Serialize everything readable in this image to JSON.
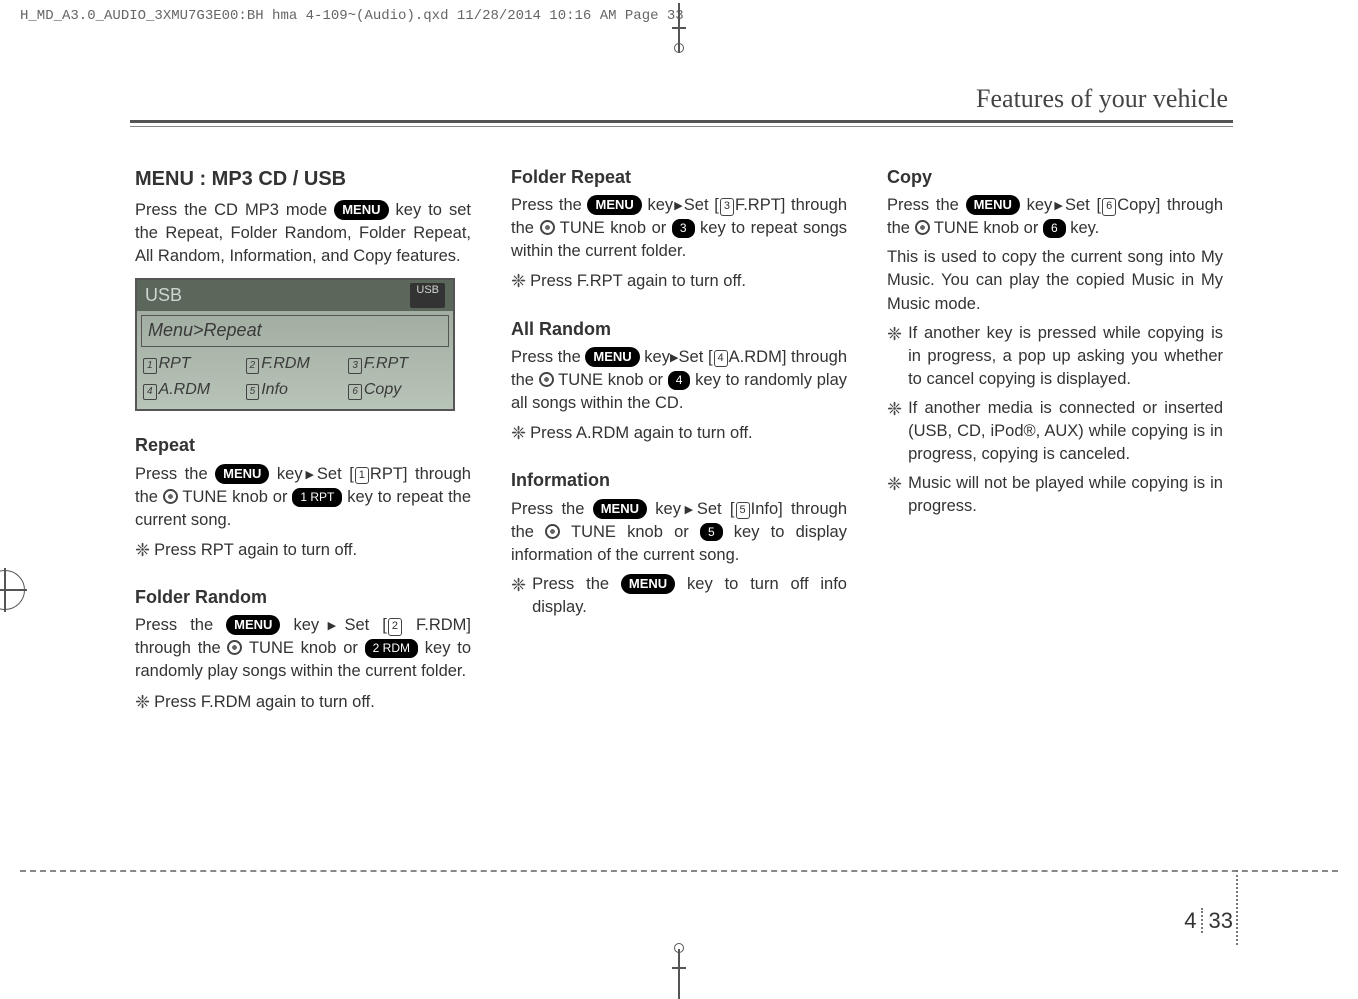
{
  "file_header": "H_MD_A3.0_AUDIO_3XMU7G3E00:BH hma 4-109~(Audio).qxd  11/28/2014  10:16 AM  Page 33",
  "chapter_title": "Features of your vehicle",
  "page_chapter": "4",
  "page_num": "33",
  "buttons": {
    "menu": "MENU",
    "k1": "1 RPT",
    "k2": "2 RDM",
    "k3": "3",
    "k4": "4",
    "k5": "5",
    "k6": "6"
  },
  "boxnums": {
    "n1": "1",
    "n2": "2",
    "n3": "3",
    "n4": "4",
    "n5": "5",
    "n6": "6"
  },
  "lcd": {
    "title": "USB",
    "badge": "USB",
    "menu": "Menu>Repeat",
    "c1": "RPT",
    "c2": "F.RDM",
    "c3": "F.RPT",
    "c4": "A.RDM",
    "c5": "Info",
    "c6": "Copy"
  },
  "col1": {
    "h1": "MENU : MP3 CD / USB",
    "p1a": "Press the CD MP3 mode ",
    "p1b": " key to set the Repeat, Folder Random, Folder Repeat, All Random, Information, and Copy features.",
    "h2": "Repeat",
    "p2a": "Press the ",
    "p2b": " key",
    "p2c": "Set [",
    "p2d": "RPT] through the ",
    "p2e": " TUNE knob or ",
    "p2f": " key to repeat the current song.",
    "note1": "Press RPT again to turn off.",
    "h3": "Folder Random",
    "p3a": "Press the ",
    "p3b": " key",
    "p3c": "Set [",
    "p3d": " F.RDM] through the ",
    "p3e": " TUNE knob or ",
    "p3f": " key to randomly play songs within the current folder.",
    "note2": "Press F.RDM again to turn off."
  },
  "col2": {
    "h1": "Folder Repeat",
    "p1a": "Press the ",
    "p1b": " key",
    "p1c": "Set [",
    "p1d": "F.RPT] through the ",
    "p1e": " TUNE knob or ",
    "p1f": " key to repeat songs within the current folder.",
    "note1": "Press F.RPT again to turn off.",
    "h2": "All Random",
    "p2a": "Press the ",
    "p2b": " key",
    "p2c": "Set [",
    "p2d": "A.RDM] through the ",
    "p2e": " TUNE knob or ",
    "p2f": " key to randomly play all songs within the CD.",
    "note2": "Press A.RDM again to turn off.",
    "h3": "Information",
    "p3a": "Press the ",
    "p3b": " key",
    "p3c": "Set [",
    "p3d": "Info] through the ",
    "p3e": " TUNE knob or ",
    "p3f": " key to display information of the current song.",
    "note3a": "Press the ",
    "note3b": " key to turn off info display."
  },
  "col3": {
    "h1": "Copy",
    "p1a": "Press the ",
    "p1b": " key",
    "p1c": "Set [",
    "p1d": "Copy] through the ",
    "p1e": " TUNE knob or ",
    "p1f": " key.",
    "p2": "This is used to copy the current song into My Music. You can play the copied Music in My Music mode.",
    "b1": "If another key is pressed while copying is in progress, a pop up asking you whether to cancel copying is displayed.",
    "b2": "If another media is connected or inserted (USB, CD, iPod®, AUX) while copying is in progress, copying is canceled.",
    "b3": "Music will not be played while copying is in progress."
  }
}
